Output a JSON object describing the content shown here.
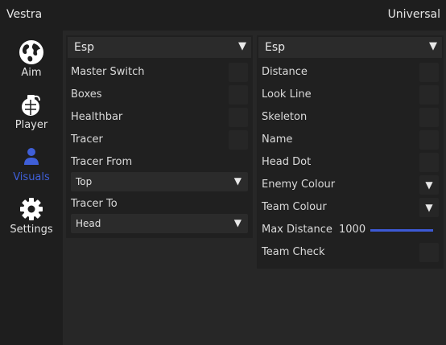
{
  "header": {
    "app_title": "Vestra",
    "game_title": "Universal"
  },
  "sidebar": {
    "items": [
      {
        "label": "Aim",
        "icon": "globe-icon"
      },
      {
        "label": "Player",
        "icon": "grenade-icon"
      },
      {
        "label": "Visuals",
        "icon": "person-icon"
      },
      {
        "label": "Settings",
        "icon": "gear-icon"
      }
    ],
    "active": "Visuals",
    "accent_color": "#3f5fd8"
  },
  "left_panel": {
    "title": "Esp",
    "toggles": [
      "Master Switch",
      "Boxes",
      "Healthbar",
      "Tracer"
    ],
    "tracer_from": {
      "label": "Tracer From",
      "value": "Top"
    },
    "tracer_to": {
      "label": "Tracer To",
      "value": "Head"
    }
  },
  "right_panel": {
    "title": "Esp",
    "toggles_top": [
      "Distance",
      "Look Line",
      "Skeleton",
      "Name",
      "Head Dot"
    ],
    "enemy_colour": {
      "label": "Enemy Colour"
    },
    "team_colour": {
      "label": "Team Colour"
    },
    "max_distance": {
      "label": "Max Distance",
      "value": "1000",
      "fill_fraction": 1.0
    },
    "team_check": {
      "label": "Team Check"
    }
  }
}
